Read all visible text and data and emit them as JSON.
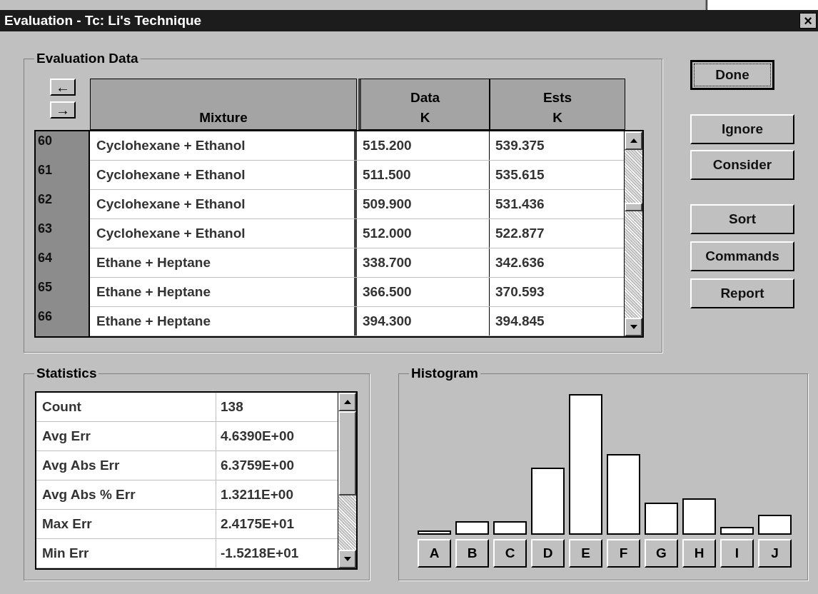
{
  "window": {
    "title": "Evaluation - Tc: Li's Technique",
    "close": "×"
  },
  "evaluation_data": {
    "title": "Evaluation Data",
    "nav": [
      "←",
      "→"
    ],
    "columns": [
      {
        "lines": [
          "Mixture"
        ]
      },
      {
        "lines": [
          "Data",
          "K"
        ]
      },
      {
        "lines": [
          "Ests",
          "K"
        ]
      }
    ],
    "rows": [
      {
        "index": "60",
        "mixture": "Cyclohexane + Ethanol",
        "data": "515.200",
        "ests": "539.375"
      },
      {
        "index": "61",
        "mixture": "Cyclohexane + Ethanol",
        "data": "511.500",
        "ests": "535.615"
      },
      {
        "index": "62",
        "mixture": "Cyclohexane + Ethanol",
        "data": "509.900",
        "ests": "531.436"
      },
      {
        "index": "63",
        "mixture": "Cyclohexane + Ethanol",
        "data": "512.000",
        "ests": "522.877"
      },
      {
        "index": "64",
        "mixture": "Ethane + Heptane",
        "data": "338.700",
        "ests": "342.636"
      },
      {
        "index": "65",
        "mixture": "Ethane + Heptane",
        "data": "366.500",
        "ests": "370.593"
      },
      {
        "index": "66",
        "mixture": "Ethane + Heptane",
        "data": "394.300",
        "ests": "394.845"
      }
    ]
  },
  "buttons": [
    {
      "label": "Done",
      "focused": true
    },
    {
      "label": "Ignore",
      "focused": false
    },
    {
      "label": "Consider",
      "focused": false
    },
    {
      "label": "Sort",
      "focused": false
    },
    {
      "label": "Commands",
      "focused": false
    },
    {
      "label": "Report",
      "focused": false
    }
  ],
  "statistics": {
    "title": "Statistics",
    "rows": [
      {
        "label": "Count",
        "value": "138"
      },
      {
        "label": "Avg Err",
        "value": "4.6390E+00"
      },
      {
        "label": "Avg Abs Err",
        "value": "6.3759E+00"
      },
      {
        "label": "Avg Abs % Err",
        "value": "1.3211E+00"
      },
      {
        "label": "Max Err",
        "value": "2.4175E+01"
      },
      {
        "label": "Min Err",
        "value": "-1.5218E+01"
      }
    ]
  },
  "histogram": {
    "title": "Histogram",
    "bins": [
      "A",
      "B",
      "C",
      "D",
      "E",
      "F",
      "G",
      "H",
      "I",
      "J"
    ]
  }
}
